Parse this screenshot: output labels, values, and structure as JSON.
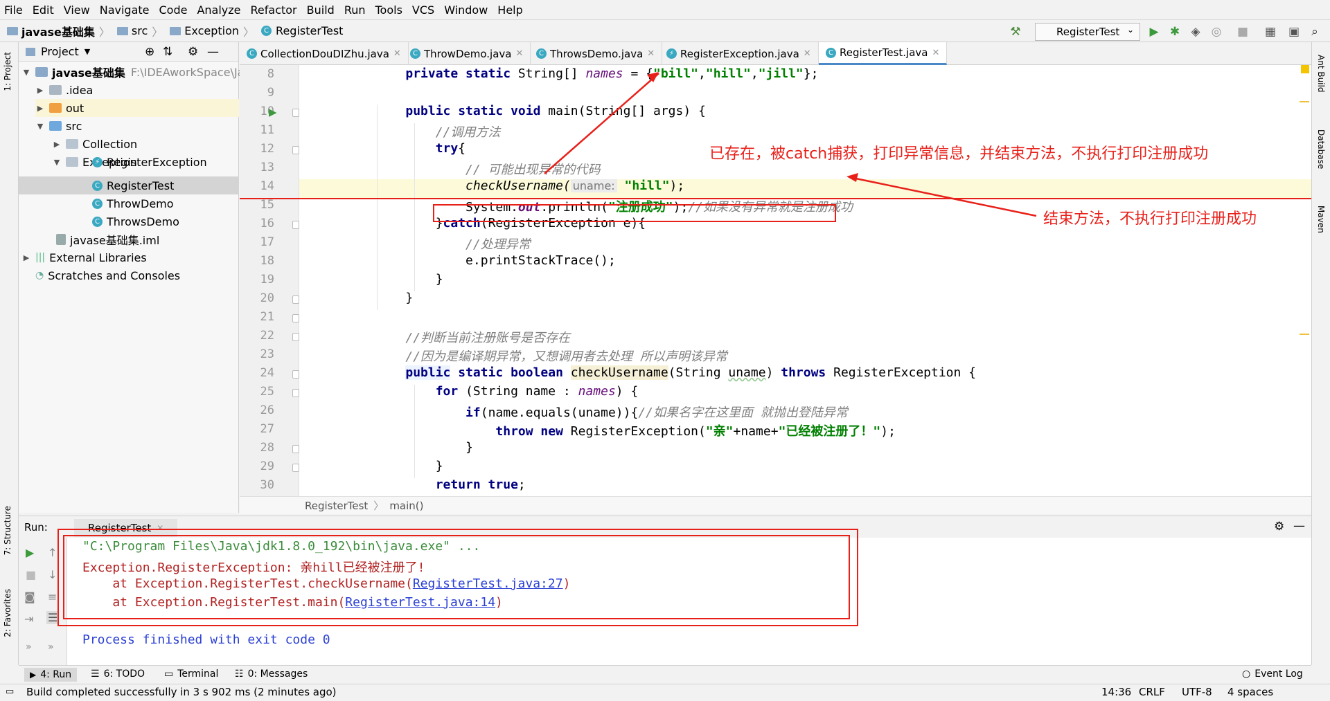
{
  "menu": [
    "File",
    "Edit",
    "View",
    "Navigate",
    "Code",
    "Analyze",
    "Refactor",
    "Build",
    "Run",
    "Tools",
    "VCS",
    "Window",
    "Help"
  ],
  "breadcrumb": [
    "javase基础集",
    "src",
    "Exception",
    "RegisterTest"
  ],
  "run_config": "RegisterTest",
  "project": {
    "header": "Project",
    "root": "javase基础集",
    "root_path": "F:\\IDEAworkSpace\\Java",
    "items": [
      ".idea",
      "out",
      "src",
      "Collection",
      "Exception",
      "RegisterException",
      "RegisterTest",
      "ThrowDemo",
      "ThrowsDemo",
      "javase基础集.iml",
      "External Libraries",
      "Scratches and Consoles"
    ]
  },
  "left_tabs": {
    "project": "1: Project",
    "structure": "7: Structure",
    "favorites": "2: Favorites"
  },
  "right_tabs": {
    "ant": "Ant Build",
    "database": "Database",
    "maven": "Maven"
  },
  "editor_tabs": [
    "CollectionDouDIZhu.java",
    "ThrowDemo.java",
    "ThrowsDemo.java",
    "RegisterException.java",
    "RegisterTest.java"
  ],
  "line_numbers": [
    "8",
    "9",
    "10",
    "11",
    "12",
    "13",
    "14",
    "15",
    "16",
    "17",
    "18",
    "19",
    "20",
    "21",
    "22",
    "23",
    "24",
    "25",
    "26",
    "27",
    "28",
    "29",
    "30"
  ],
  "code": {
    "l8_kw": "private static",
    "l8_a": " String[] ",
    "l8_fld": "names",
    "l8_b": " = {",
    "l8_s1": "\"bill\"",
    "l8_c": ",",
    "l8_s2": "\"hill\"",
    "l8_d": ",",
    "l8_s3": "\"jill\"",
    "l8_e": "};",
    "l10_kw": "public static void",
    "l10_a": " main(String[] args) {",
    "l11": "//调用方法",
    "l12": "try",
    "l12_b": "{",
    "l13": "// 可能出现异常的代码",
    "l14_a": "checkUsername(",
    "l14_hint": "uname:",
    "l14_s": "\"hill\"",
    "l14_b": ");",
    "l15_a": "System.",
    "l15_fld": "out",
    "l15_b": ".println(",
    "l15_s": "\"注册成功\"",
    "l15_c": ");",
    "l15_cmt": "//如果没有异常就是注册成功",
    "l16_a": "}",
    "l16_kw": "catch",
    "l16_b": "(RegisterException e){",
    "l17": "//处理异常",
    "l18": "e.printStackTrace();",
    "l19": "}",
    "l20": "}",
    "l22": "//判断当前注册账号是否存在",
    "l23": "//因为是编译期异常，又想调用者去处理 所以声明该异常",
    "l24_kw1": "public",
    "l24_kw2": " static boolean ",
    "l24_m": "checkUsername",
    "l24_a": "(String ",
    "l24_p": "uname",
    "l24_b": ") ",
    "l24_kw3": "throws",
    "l24_c": " RegisterException {",
    "l25_kw": "for",
    "l25_a": " (String name : ",
    "l25_fld": "names",
    "l25_b": ") {",
    "l26_kw": "if",
    "l26_a": "(name.equals(uname)){",
    "l26_cmt": "//如果名字在这里面 就抛出登陆异常",
    "l27_kw": "throw new",
    "l27_a": " RegisterException(",
    "l27_s1": "\"亲\"",
    "l27_b": "+name+",
    "l27_s2": "\"已经被注册了！\"",
    "l27_c": ");",
    "l28": "}",
    "l29": "}",
    "l30_kw": "return true",
    "l30_a": ";"
  },
  "annotations": {
    "top": "已存在，被catch捕获，打印异常信息，并结束方法，不执行打印注册成功",
    "bottom": "结束方法，不执行打印注册成功"
  },
  "editor_breadcrumb": [
    "RegisterTest",
    "main()"
  ],
  "run": {
    "label": "Run:",
    "tab": "RegisterTest",
    "lines": {
      "cmd": "\"C:\\Program Files\\Java\\jdk1.8.0_192\\bin\\java.exe\" ...",
      "exc": "Exception.RegisterException: 亲hill已经被注册了!",
      "at1_a": "    at Exception.RegisterTest.checkUsername(",
      "at1_link": "RegisterTest.java:27",
      "at1_b": ")",
      "at2_a": "    at Exception.RegisterTest.main(",
      "at2_link": "RegisterTest.java:14",
      "at2_b": ")",
      "finish": "Process finished with exit code 0"
    }
  },
  "bottom_tabs": [
    "4: Run",
    "6: TODO",
    "Terminal",
    "0: Messages",
    "Event Log"
  ],
  "status": {
    "message": "Build completed successfully in 3 s 902 ms (2 minutes ago)",
    "position": "14:36",
    "line_sep": "CRLF",
    "encoding": "UTF-8",
    "indent": "4 spaces"
  },
  "colors": {
    "annotation": "#e8201a",
    "keyword": "#000080",
    "string": "#008000",
    "comment": "#808080",
    "field": "#660e7a",
    "console_error": "#b22222",
    "console_cmd": "#3c8c3c",
    "console_normal": "#2a3fd4"
  }
}
